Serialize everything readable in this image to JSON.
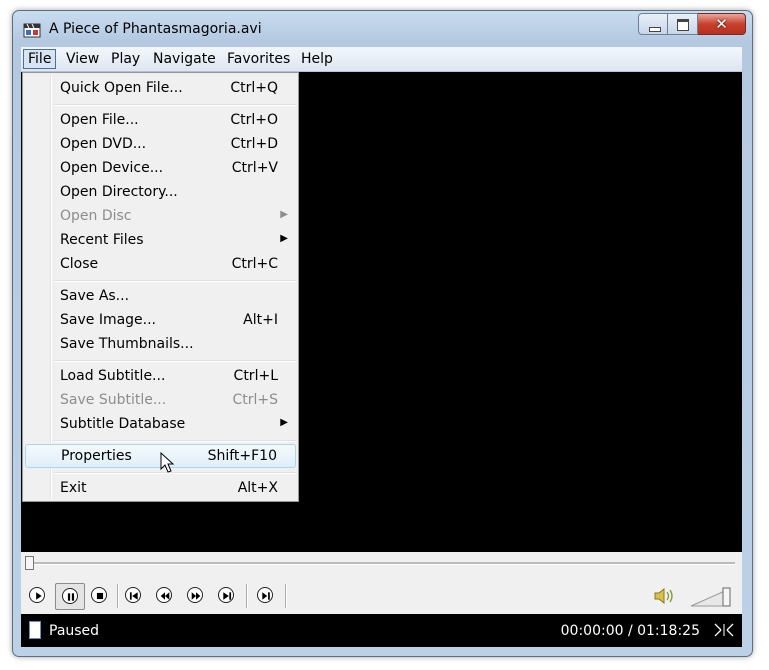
{
  "window": {
    "title": "A Piece of Phantasmagoria.avi",
    "caption_buttons": {
      "minimize": "minimize-icon",
      "maximize": "maximize-icon",
      "close": "✕"
    }
  },
  "menubar": {
    "items": [
      "File",
      "View",
      "Play",
      "Navigate",
      "Favorites",
      "Help"
    ],
    "active": "File"
  },
  "file_menu": {
    "items": [
      {
        "label": "Quick Open File...",
        "shortcut": "Ctrl+Q"
      },
      {
        "label": "Open File...",
        "shortcut": "Ctrl+O"
      },
      {
        "label": "Open DVD...",
        "shortcut": "Ctrl+D"
      },
      {
        "label": "Open Device...",
        "shortcut": "Ctrl+V"
      },
      {
        "label": "Open Directory...",
        "shortcut": ""
      },
      {
        "label": "Open Disc",
        "shortcut": "",
        "submenu": true,
        "disabled": true
      },
      {
        "label": "Recent Files",
        "shortcut": "",
        "submenu": true
      },
      {
        "label": "Close",
        "shortcut": "Ctrl+C"
      },
      {
        "label": "Save As...",
        "shortcut": ""
      },
      {
        "label": "Save Image...",
        "shortcut": "Alt+I"
      },
      {
        "label": "Save Thumbnails...",
        "shortcut": ""
      },
      {
        "label": "Load Subtitle...",
        "shortcut": "Ctrl+L"
      },
      {
        "label": "Save Subtitle...",
        "shortcut": "Ctrl+S",
        "disabled": true
      },
      {
        "label": "Subtitle Database",
        "shortcut": "",
        "submenu": true
      },
      {
        "label": "Properties",
        "shortcut": "Shift+F10",
        "highlighted": true
      },
      {
        "label": "Exit",
        "shortcut": "Alt+X"
      }
    ]
  },
  "player": {
    "seek_position": 0,
    "controls": [
      "play-icon",
      "pause-icon",
      "stop-icon",
      "skip-back-icon",
      "rewind-icon",
      "fast-forward-icon",
      "skip-forward-icon",
      "frame-step-icon"
    ],
    "pressed_control": "pause-icon",
    "volume_level": 1.0
  },
  "status": {
    "text": "Paused",
    "time": "00:00:00 / 01:18:25"
  },
  "colors": {
    "menu_highlight_border": "#a8d8eb",
    "disabled_text": "#8d8d8d",
    "video_background": "#000000",
    "status_text": "#ffffff"
  }
}
